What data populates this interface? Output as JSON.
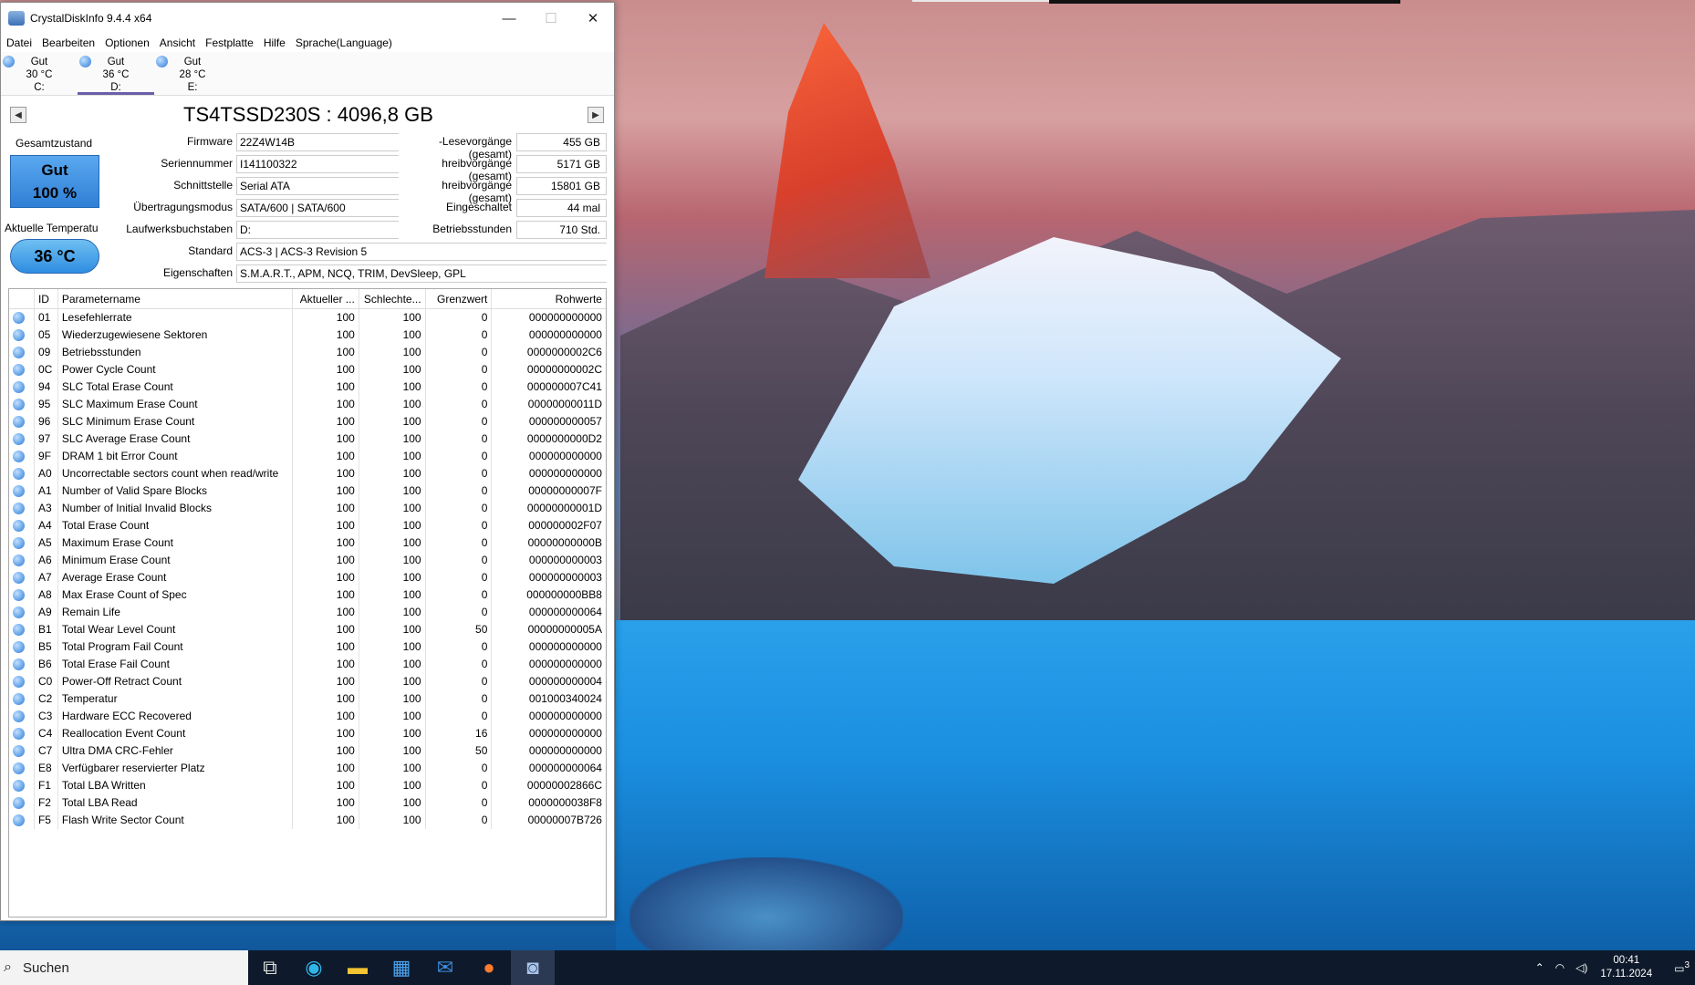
{
  "window": {
    "title": "CrystalDiskInfo 9.4.4 x64",
    "controls": {
      "minimize": "—",
      "maximize": "☐",
      "close": "✕"
    }
  },
  "menu": [
    "Datei",
    "Bearbeiten",
    "Optionen",
    "Ansicht",
    "Festplatte",
    "Hilfe",
    "Sprache(Language)"
  ],
  "drives": [
    {
      "status": "Gut",
      "temp": "30 °C",
      "letter": "C:"
    },
    {
      "status": "Gut",
      "temp": "36 °C",
      "letter": "D:"
    },
    {
      "status": "Gut",
      "temp": "28 °C",
      "letter": "E:"
    }
  ],
  "disk": {
    "model": "TS4TSSD230S : 4096,8 GB",
    "health_label": "Gesamtzustand",
    "health_status": "Gut",
    "health_percent": "100 %",
    "temp_label": "Aktuelle Temperatu",
    "temperature": "36 °C",
    "fields": {
      "firmware_label": "Firmware",
      "firmware": "22Z4W14B",
      "serial_label": "Seriennummer",
      "serial": "I141100322",
      "interface_label": "Schnittstelle",
      "interface": "Serial ATA",
      "transfer_label": "Übertragungsmodus",
      "transfer": "SATA/600 | SATA/600",
      "letters_label": "Laufwerksbuchstaben",
      "letters": "D:",
      "standard_label": "Standard",
      "standard": "ACS-3 | ACS-3 Revision 5",
      "features_label": "Eigenschaften",
      "features": "S.M.A.R.T., APM, NCQ, TRIM, DevSleep, GPL"
    },
    "right": {
      "reads_label": "-Lesevorgänge (gesamt)",
      "reads": "455 GB",
      "writes_label": "hreibvorgänge (gesamt)",
      "writes": "5171 GB",
      "nand_label": "hreibvorgänge (gesamt)",
      "nand": "15801 GB",
      "power_on_count_label": "Eingeschaltet",
      "power_on_count": "44 mal",
      "hours_label": "Betriebsstunden",
      "hours": "710 Std."
    }
  },
  "smart": {
    "headers": [
      "",
      "ID",
      "Parametername",
      "Aktueller ...",
      "Schlechte...",
      "Grenzwert",
      "Rohwerte"
    ],
    "rows": [
      [
        "01",
        "Lesefehlerrate",
        "100",
        "100",
        "0",
        "000000000000"
      ],
      [
        "05",
        "Wiederzugewiesene Sektoren",
        "100",
        "100",
        "0",
        "000000000000"
      ],
      [
        "09",
        "Betriebsstunden",
        "100",
        "100",
        "0",
        "0000000002C6"
      ],
      [
        "0C",
        "Power Cycle Count",
        "100",
        "100",
        "0",
        "00000000002C"
      ],
      [
        "94",
        "SLC Total Erase Count",
        "100",
        "100",
        "0",
        "000000007C41"
      ],
      [
        "95",
        "SLC Maximum Erase Count",
        "100",
        "100",
        "0",
        "00000000011D"
      ],
      [
        "96",
        "SLC Minimum Erase Count",
        "100",
        "100",
        "0",
        "000000000057"
      ],
      [
        "97",
        "SLC Average Erase Count",
        "100",
        "100",
        "0",
        "0000000000D2"
      ],
      [
        "9F",
        "DRAM 1 bit Error Count",
        "100",
        "100",
        "0",
        "000000000000"
      ],
      [
        "A0",
        "Uncorrectable sectors count when read/write",
        "100",
        "100",
        "0",
        "000000000000"
      ],
      [
        "A1",
        "Number of Valid Spare Blocks",
        "100",
        "100",
        "0",
        "00000000007F"
      ],
      [
        "A3",
        "Number of Initial Invalid Blocks",
        "100",
        "100",
        "0",
        "00000000001D"
      ],
      [
        "A4",
        "Total Erase Count",
        "100",
        "100",
        "0",
        "000000002F07"
      ],
      [
        "A5",
        "Maximum Erase Count",
        "100",
        "100",
        "0",
        "00000000000B"
      ],
      [
        "A6",
        "Minimum Erase Count",
        "100",
        "100",
        "0",
        "000000000003"
      ],
      [
        "A7",
        "Average Erase Count",
        "100",
        "100",
        "0",
        "000000000003"
      ],
      [
        "A8",
        "Max Erase Count of Spec",
        "100",
        "100",
        "0",
        "000000000BB8"
      ],
      [
        "A9",
        "Remain Life",
        "100",
        "100",
        "0",
        "000000000064"
      ],
      [
        "B1",
        "Total Wear Level Count",
        "100",
        "100",
        "50",
        "00000000005A"
      ],
      [
        "B5",
        "Total Program Fail Count",
        "100",
        "100",
        "0",
        "000000000000"
      ],
      [
        "B6",
        "Total Erase Fail Count",
        "100",
        "100",
        "0",
        "000000000000"
      ],
      [
        "C0",
        "Power-Off Retract Count",
        "100",
        "100",
        "0",
        "000000000004"
      ],
      [
        "C2",
        "Temperatur",
        "100",
        "100",
        "0",
        "001000340024"
      ],
      [
        "C3",
        "Hardware ECC Recovered",
        "100",
        "100",
        "0",
        "000000000000"
      ],
      [
        "C4",
        "Reallocation Event Count",
        "100",
        "100",
        "16",
        "000000000000"
      ],
      [
        "C7",
        "Ultra DMA CRC-Fehler",
        "100",
        "100",
        "50",
        "000000000000"
      ],
      [
        "E8",
        "Verfügbarer reservierter Platz",
        "100",
        "100",
        "0",
        "000000000064"
      ],
      [
        "F1",
        "Total LBA Written",
        "100",
        "100",
        "0",
        "00000002866C"
      ],
      [
        "F2",
        "Total LBA Read",
        "100",
        "100",
        "0",
        "0000000038F8"
      ],
      [
        "F5",
        "Flash Write Sector Count",
        "100",
        "100",
        "0",
        "00000007B726"
      ]
    ]
  },
  "taskbar": {
    "search_text": "Suchen",
    "time": "00:41",
    "date": "17.11.2024",
    "notification_count": "3"
  }
}
